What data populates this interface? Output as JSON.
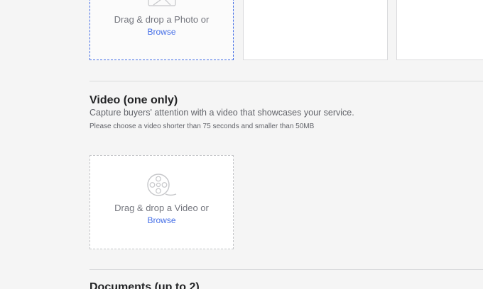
{
  "photos": {
    "slots": [
      {
        "drop_text": "Drag & drop a Photo or",
        "browse_label": "Browse"
      }
    ]
  },
  "video": {
    "title": "Video (one only)",
    "description": "Capture buyers' attention with a video that showcases your service.",
    "note": "Please choose a video shorter than 75 seconds and smaller than 50MB",
    "drop_text": "Drag & drop a Video or",
    "browse_label": "Browse",
    "icon": "video-reel-icon"
  },
  "documents": {
    "title": "Documents (up to 2)"
  },
  "colors": {
    "link": "#446ee7",
    "muted_text": "#74767e",
    "border": "#dadbdd",
    "background": "#f5f5f5"
  }
}
